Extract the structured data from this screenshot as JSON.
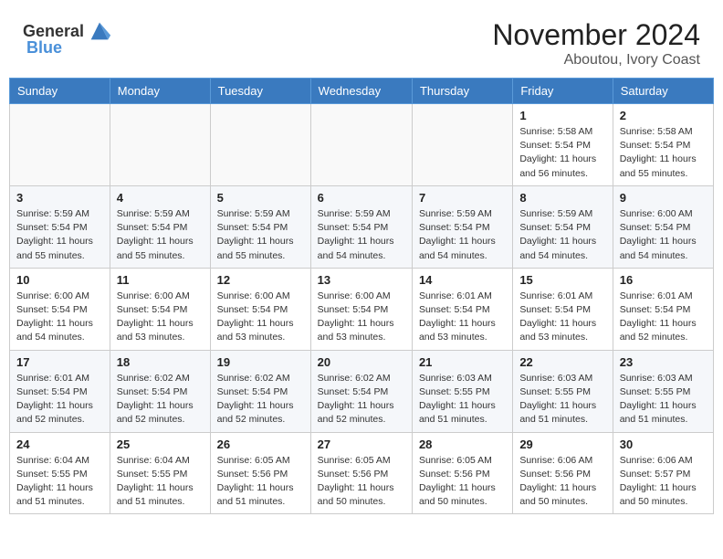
{
  "header": {
    "logo_general": "General",
    "logo_blue": "Blue",
    "month_year": "November 2024",
    "location": "Aboutou, Ivory Coast"
  },
  "weekdays": [
    "Sunday",
    "Monday",
    "Tuesday",
    "Wednesday",
    "Thursday",
    "Friday",
    "Saturday"
  ],
  "weeks": [
    [
      {
        "day": "",
        "info": ""
      },
      {
        "day": "",
        "info": ""
      },
      {
        "day": "",
        "info": ""
      },
      {
        "day": "",
        "info": ""
      },
      {
        "day": "",
        "info": ""
      },
      {
        "day": "1",
        "info": "Sunrise: 5:58 AM\nSunset: 5:54 PM\nDaylight: 11 hours\nand 56 minutes."
      },
      {
        "day": "2",
        "info": "Sunrise: 5:58 AM\nSunset: 5:54 PM\nDaylight: 11 hours\nand 55 minutes."
      }
    ],
    [
      {
        "day": "3",
        "info": "Sunrise: 5:59 AM\nSunset: 5:54 PM\nDaylight: 11 hours\nand 55 minutes."
      },
      {
        "day": "4",
        "info": "Sunrise: 5:59 AM\nSunset: 5:54 PM\nDaylight: 11 hours\nand 55 minutes."
      },
      {
        "day": "5",
        "info": "Sunrise: 5:59 AM\nSunset: 5:54 PM\nDaylight: 11 hours\nand 55 minutes."
      },
      {
        "day": "6",
        "info": "Sunrise: 5:59 AM\nSunset: 5:54 PM\nDaylight: 11 hours\nand 54 minutes."
      },
      {
        "day": "7",
        "info": "Sunrise: 5:59 AM\nSunset: 5:54 PM\nDaylight: 11 hours\nand 54 minutes."
      },
      {
        "day": "8",
        "info": "Sunrise: 5:59 AM\nSunset: 5:54 PM\nDaylight: 11 hours\nand 54 minutes."
      },
      {
        "day": "9",
        "info": "Sunrise: 6:00 AM\nSunset: 5:54 PM\nDaylight: 11 hours\nand 54 minutes."
      }
    ],
    [
      {
        "day": "10",
        "info": "Sunrise: 6:00 AM\nSunset: 5:54 PM\nDaylight: 11 hours\nand 54 minutes."
      },
      {
        "day": "11",
        "info": "Sunrise: 6:00 AM\nSunset: 5:54 PM\nDaylight: 11 hours\nand 53 minutes."
      },
      {
        "day": "12",
        "info": "Sunrise: 6:00 AM\nSunset: 5:54 PM\nDaylight: 11 hours\nand 53 minutes."
      },
      {
        "day": "13",
        "info": "Sunrise: 6:00 AM\nSunset: 5:54 PM\nDaylight: 11 hours\nand 53 minutes."
      },
      {
        "day": "14",
        "info": "Sunrise: 6:01 AM\nSunset: 5:54 PM\nDaylight: 11 hours\nand 53 minutes."
      },
      {
        "day": "15",
        "info": "Sunrise: 6:01 AM\nSunset: 5:54 PM\nDaylight: 11 hours\nand 53 minutes."
      },
      {
        "day": "16",
        "info": "Sunrise: 6:01 AM\nSunset: 5:54 PM\nDaylight: 11 hours\nand 52 minutes."
      }
    ],
    [
      {
        "day": "17",
        "info": "Sunrise: 6:01 AM\nSunset: 5:54 PM\nDaylight: 11 hours\nand 52 minutes."
      },
      {
        "day": "18",
        "info": "Sunrise: 6:02 AM\nSunset: 5:54 PM\nDaylight: 11 hours\nand 52 minutes."
      },
      {
        "day": "19",
        "info": "Sunrise: 6:02 AM\nSunset: 5:54 PM\nDaylight: 11 hours\nand 52 minutes."
      },
      {
        "day": "20",
        "info": "Sunrise: 6:02 AM\nSunset: 5:54 PM\nDaylight: 11 hours\nand 52 minutes."
      },
      {
        "day": "21",
        "info": "Sunrise: 6:03 AM\nSunset: 5:55 PM\nDaylight: 11 hours\nand 51 minutes."
      },
      {
        "day": "22",
        "info": "Sunrise: 6:03 AM\nSunset: 5:55 PM\nDaylight: 11 hours\nand 51 minutes."
      },
      {
        "day": "23",
        "info": "Sunrise: 6:03 AM\nSunset: 5:55 PM\nDaylight: 11 hours\nand 51 minutes."
      }
    ],
    [
      {
        "day": "24",
        "info": "Sunrise: 6:04 AM\nSunset: 5:55 PM\nDaylight: 11 hours\nand 51 minutes."
      },
      {
        "day": "25",
        "info": "Sunrise: 6:04 AM\nSunset: 5:55 PM\nDaylight: 11 hours\nand 51 minutes."
      },
      {
        "day": "26",
        "info": "Sunrise: 6:05 AM\nSunset: 5:56 PM\nDaylight: 11 hours\nand 51 minutes."
      },
      {
        "day": "27",
        "info": "Sunrise: 6:05 AM\nSunset: 5:56 PM\nDaylight: 11 hours\nand 50 minutes."
      },
      {
        "day": "28",
        "info": "Sunrise: 6:05 AM\nSunset: 5:56 PM\nDaylight: 11 hours\nand 50 minutes."
      },
      {
        "day": "29",
        "info": "Sunrise: 6:06 AM\nSunset: 5:56 PM\nDaylight: 11 hours\nand 50 minutes."
      },
      {
        "day": "30",
        "info": "Sunrise: 6:06 AM\nSunset: 5:57 PM\nDaylight: 11 hours\nand 50 minutes."
      }
    ]
  ]
}
